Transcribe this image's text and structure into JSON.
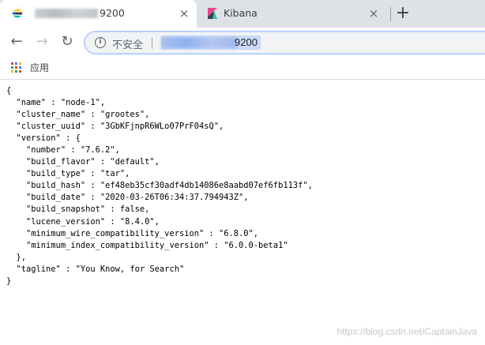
{
  "tabs": [
    {
      "title_suffix": "9200",
      "icon": "elasticsearch-favicon",
      "active": true,
      "close_glyph": "×"
    },
    {
      "title": "Kibana",
      "icon": "kibana-favicon",
      "active": false,
      "close_glyph": "×"
    }
  ],
  "new_tab_glyph": "+",
  "toolbar": {
    "back_glyph": "←",
    "forward_glyph": "→",
    "reload_glyph": "↻",
    "security_label": "不安全",
    "url_suffix": "9200"
  },
  "bookmarks": {
    "apps_label": "应用"
  },
  "json_response": "{\n  \"name\" : \"node-1\",\n  \"cluster_name\" : \"grootes\",\n  \"cluster_uuid\" : \"3GbKFjnpR6WLo07PrF04sQ\",\n  \"version\" : {\n    \"number\" : \"7.6.2\",\n    \"build_flavor\" : \"default\",\n    \"build_type\" : \"tar\",\n    \"build_hash\" : \"ef48eb35cf30adf4db14086e8aabd07ef6fb113f\",\n    \"build_date\" : \"2020-03-26T06:34:37.794943Z\",\n    \"build_snapshot\" : false,\n    \"lucene_version\" : \"8.4.0\",\n    \"minimum_wire_compatibility_version\" : \"6.8.0\",\n    \"minimum_index_compatibility_version\" : \"6.0.0-beta1\"\n  },\n  \"tagline\" : \"You Know, for Search\"\n}",
  "watermark": "https://blog.csdn.net/CaptainJava",
  "colors": {
    "tabstrip_bg": "#dee1e6",
    "omnibox_bg": "#f1f3f4",
    "kibana_pink": "#e8478b",
    "kibana_teal": "#3ebeb0",
    "elastic_yellow": "#fec514",
    "elastic_blue": "#07c"
  }
}
